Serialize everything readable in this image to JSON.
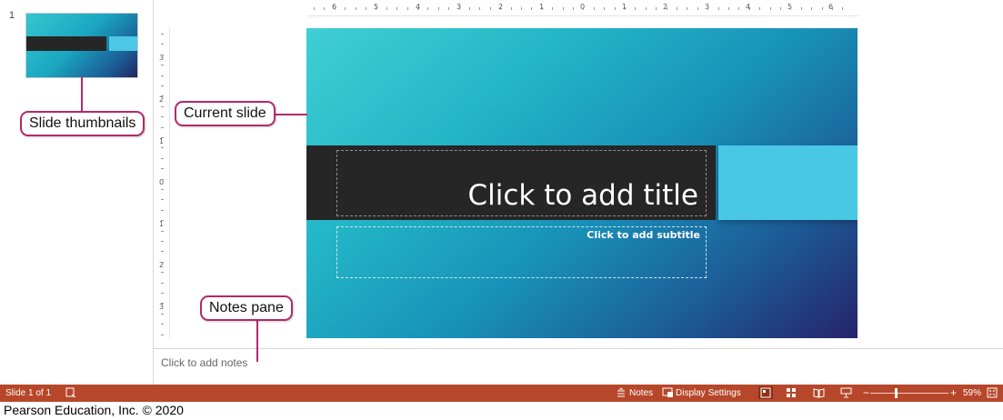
{
  "thumbnails": {
    "slide_number": "1"
  },
  "ruler": {
    "horizontal_ticks": [
      "6",
      "5",
      "4",
      "3",
      "2",
      "1",
      "0",
      "1",
      "2",
      "3",
      "4",
      "5",
      "6"
    ],
    "vertical_ticks": [
      "3",
      "2",
      "1",
      "0",
      "1",
      "2",
      "3"
    ]
  },
  "slide": {
    "title_placeholder": "Click to add title",
    "subtitle_placeholder": "Click to add subtitle"
  },
  "notes": {
    "placeholder": "Click to add notes"
  },
  "callouts": {
    "slide_thumbnails": "Slide thumbnails",
    "current_slide": "Current slide",
    "notes_pane": "Notes pane"
  },
  "statusbar": {
    "slide_info": "Slide 1 of 1",
    "notes_label": "Notes",
    "display_settings_label": "Display Settings",
    "zoom_minus": "−",
    "zoom_plus": "+",
    "zoom_level": "59%",
    "zoom_fraction": 0.59
  },
  "credit": "Pearson Education, Inc. © 2020",
  "colors": {
    "statusbar": "#b7472a",
    "callout_border": "#b3296a",
    "title_band": "#262626",
    "accent_box": "#48c8e3"
  },
  "icons": [
    "accessibility-icon",
    "notes-icon",
    "display-settings-icon",
    "normal-view-icon",
    "slide-sorter-icon",
    "reading-view-icon",
    "slideshow-icon",
    "fit-to-window-icon"
  ]
}
